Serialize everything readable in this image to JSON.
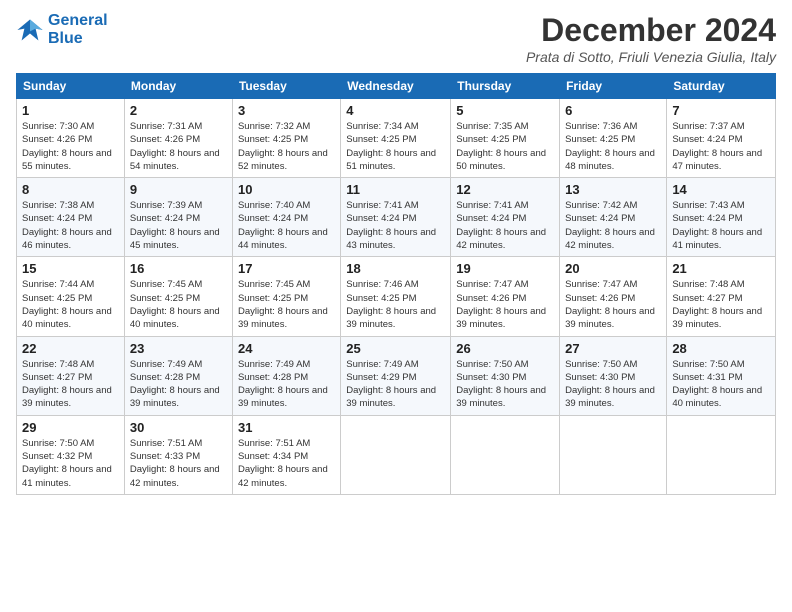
{
  "logo": {
    "line1": "General",
    "line2": "Blue"
  },
  "title": "December 2024",
  "subtitle": "Prata di Sotto, Friuli Venezia Giulia, Italy",
  "days_of_week": [
    "Sunday",
    "Monday",
    "Tuesday",
    "Wednesday",
    "Thursday",
    "Friday",
    "Saturday"
  ],
  "weeks": [
    [
      {
        "day": "1",
        "sunrise": "7:30 AM",
        "sunset": "4:26 PM",
        "daylight": "8 hours and 55 minutes."
      },
      {
        "day": "2",
        "sunrise": "7:31 AM",
        "sunset": "4:26 PM",
        "daylight": "8 hours and 54 minutes."
      },
      {
        "day": "3",
        "sunrise": "7:32 AM",
        "sunset": "4:25 PM",
        "daylight": "8 hours and 52 minutes."
      },
      {
        "day": "4",
        "sunrise": "7:34 AM",
        "sunset": "4:25 PM",
        "daylight": "8 hours and 51 minutes."
      },
      {
        "day": "5",
        "sunrise": "7:35 AM",
        "sunset": "4:25 PM",
        "daylight": "8 hours and 50 minutes."
      },
      {
        "day": "6",
        "sunrise": "7:36 AM",
        "sunset": "4:25 PM",
        "daylight": "8 hours and 48 minutes."
      },
      {
        "day": "7",
        "sunrise": "7:37 AM",
        "sunset": "4:24 PM",
        "daylight": "8 hours and 47 minutes."
      }
    ],
    [
      {
        "day": "8",
        "sunrise": "7:38 AM",
        "sunset": "4:24 PM",
        "daylight": "8 hours and 46 minutes."
      },
      {
        "day": "9",
        "sunrise": "7:39 AM",
        "sunset": "4:24 PM",
        "daylight": "8 hours and 45 minutes."
      },
      {
        "day": "10",
        "sunrise": "7:40 AM",
        "sunset": "4:24 PM",
        "daylight": "8 hours and 44 minutes."
      },
      {
        "day": "11",
        "sunrise": "7:41 AM",
        "sunset": "4:24 PM",
        "daylight": "8 hours and 43 minutes."
      },
      {
        "day": "12",
        "sunrise": "7:41 AM",
        "sunset": "4:24 PM",
        "daylight": "8 hours and 42 minutes."
      },
      {
        "day": "13",
        "sunrise": "7:42 AM",
        "sunset": "4:24 PM",
        "daylight": "8 hours and 42 minutes."
      },
      {
        "day": "14",
        "sunrise": "7:43 AM",
        "sunset": "4:24 PM",
        "daylight": "8 hours and 41 minutes."
      }
    ],
    [
      {
        "day": "15",
        "sunrise": "7:44 AM",
        "sunset": "4:25 PM",
        "daylight": "8 hours and 40 minutes."
      },
      {
        "day": "16",
        "sunrise": "7:45 AM",
        "sunset": "4:25 PM",
        "daylight": "8 hours and 40 minutes."
      },
      {
        "day": "17",
        "sunrise": "7:45 AM",
        "sunset": "4:25 PM",
        "daylight": "8 hours and 39 minutes."
      },
      {
        "day": "18",
        "sunrise": "7:46 AM",
        "sunset": "4:25 PM",
        "daylight": "8 hours and 39 minutes."
      },
      {
        "day": "19",
        "sunrise": "7:47 AM",
        "sunset": "4:26 PM",
        "daylight": "8 hours and 39 minutes."
      },
      {
        "day": "20",
        "sunrise": "7:47 AM",
        "sunset": "4:26 PM",
        "daylight": "8 hours and 39 minutes."
      },
      {
        "day": "21",
        "sunrise": "7:48 AM",
        "sunset": "4:27 PM",
        "daylight": "8 hours and 39 minutes."
      }
    ],
    [
      {
        "day": "22",
        "sunrise": "7:48 AM",
        "sunset": "4:27 PM",
        "daylight": "8 hours and 39 minutes."
      },
      {
        "day": "23",
        "sunrise": "7:49 AM",
        "sunset": "4:28 PM",
        "daylight": "8 hours and 39 minutes."
      },
      {
        "day": "24",
        "sunrise": "7:49 AM",
        "sunset": "4:28 PM",
        "daylight": "8 hours and 39 minutes."
      },
      {
        "day": "25",
        "sunrise": "7:49 AM",
        "sunset": "4:29 PM",
        "daylight": "8 hours and 39 minutes."
      },
      {
        "day": "26",
        "sunrise": "7:50 AM",
        "sunset": "4:30 PM",
        "daylight": "8 hours and 39 minutes."
      },
      {
        "day": "27",
        "sunrise": "7:50 AM",
        "sunset": "4:30 PM",
        "daylight": "8 hours and 39 minutes."
      },
      {
        "day": "28",
        "sunrise": "7:50 AM",
        "sunset": "4:31 PM",
        "daylight": "8 hours and 40 minutes."
      }
    ],
    [
      {
        "day": "29",
        "sunrise": "7:50 AM",
        "sunset": "4:32 PM",
        "daylight": "8 hours and 41 minutes."
      },
      {
        "day": "30",
        "sunrise": "7:51 AM",
        "sunset": "4:33 PM",
        "daylight": "8 hours and 42 minutes."
      },
      {
        "day": "31",
        "sunrise": "7:51 AM",
        "sunset": "4:34 PM",
        "daylight": "8 hours and 42 minutes."
      },
      null,
      null,
      null,
      null
    ]
  ],
  "labels": {
    "sunrise": "Sunrise:",
    "sunset": "Sunset:",
    "daylight": "Daylight:"
  }
}
